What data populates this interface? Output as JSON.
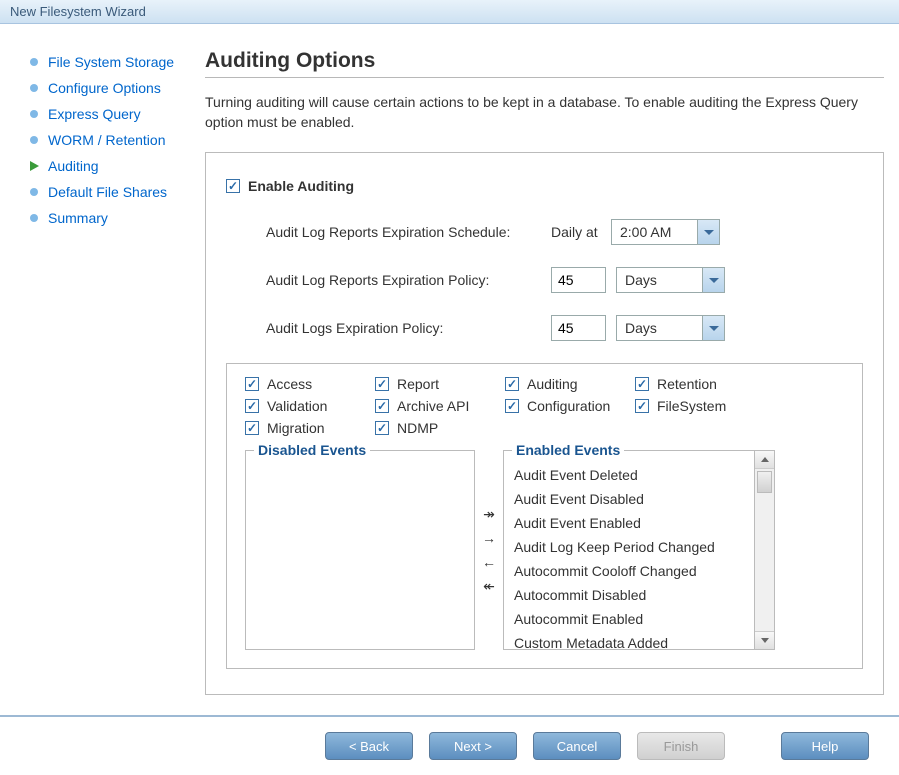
{
  "window_title": "New Filesystem Wizard",
  "sidebar": {
    "items": [
      {
        "label": "File System Storage"
      },
      {
        "label": "Configure Options"
      },
      {
        "label": "Express Query"
      },
      {
        "label": "WORM / Retention"
      },
      {
        "label": "Auditing"
      },
      {
        "label": "Default File Shares"
      },
      {
        "label": "Summary"
      }
    ]
  },
  "page": {
    "title": "Auditing Options",
    "description": "Turning auditing will cause certain actions to be kept in a database. To enable auditing the Express Query option must be enabled."
  },
  "form": {
    "enable_label": "Enable Auditing",
    "schedule_label": "Audit Log Reports Expiration Schedule:",
    "schedule_freq": "Daily at",
    "schedule_time": "2:00 AM",
    "report_policy_label": "Audit Log Reports Expiration Policy:",
    "report_policy_value": "45",
    "report_policy_unit": "Days",
    "log_policy_label": "Audit Logs Expiration Policy:",
    "log_policy_value": "45",
    "log_policy_unit": "Days"
  },
  "categories": [
    "Access",
    "Report",
    "Auditing",
    "Retention",
    "Validation",
    "Archive API",
    "Configuration",
    "FileSystem",
    "Migration",
    "NDMP"
  ],
  "events": {
    "disabled_title": "Disabled Events",
    "enabled_title": "Enabled Events",
    "disabled": [],
    "enabled": [
      "Audit Event Deleted",
      "Audit Event Disabled",
      "Audit Event Enabled",
      "Audit Log Keep Period Changed",
      "Autocommit Cooloff Changed",
      "Autocommit Disabled",
      "Autocommit Enabled",
      "Custom Metadata Added"
    ]
  },
  "buttons": {
    "back": "< Back",
    "next": "Next >",
    "cancel": "Cancel",
    "finish": "Finish",
    "help": "Help"
  }
}
